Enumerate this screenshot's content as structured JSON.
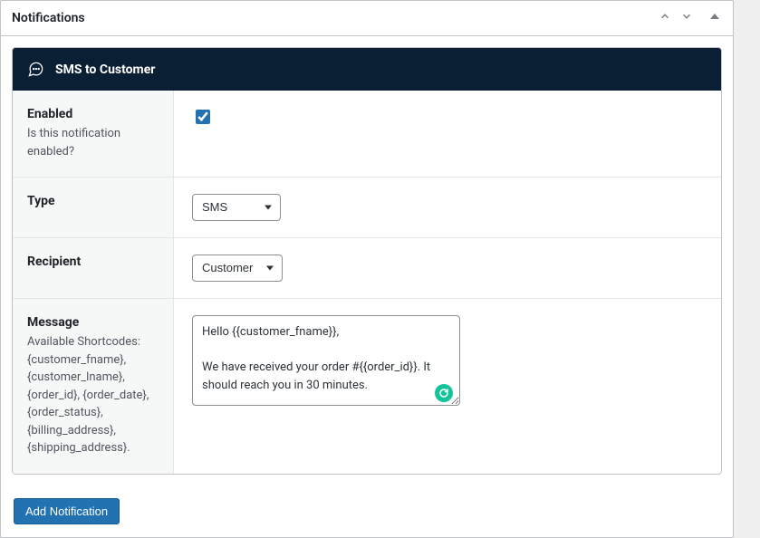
{
  "panel": {
    "title": "Notifications",
    "icons": {
      "up": "chevron-up",
      "down": "chevron-down",
      "collapse": "triangle-up"
    }
  },
  "block": {
    "title": "SMS to Customer"
  },
  "rows": {
    "enabled": {
      "label": "Enabled",
      "desc": "Is this notification enabled?",
      "checked": true
    },
    "type": {
      "label": "Type",
      "value": "SMS"
    },
    "recipient": {
      "label": "Recipient",
      "value": "Customer"
    },
    "message": {
      "label": "Message",
      "desc": "Available Shortcodes: {customer_fname}, {customer_lname}, {order_id}, {order_date}, {order_status}, {billing_address}, {shipping_address}.",
      "value": "Hello {{customer_fname}},\n\nWe have received your order #{{order_id}}. It should reach you in 30 minutes."
    }
  },
  "buttons": {
    "add": "Add Notification"
  }
}
